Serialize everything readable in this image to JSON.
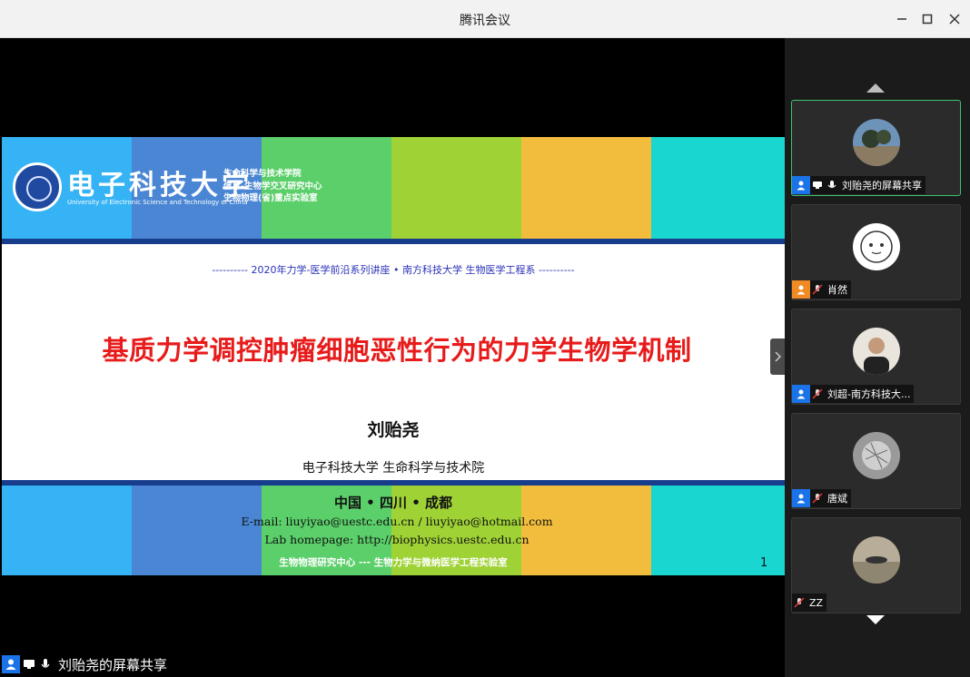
{
  "window": {
    "title": "腾讯会议"
  },
  "slide": {
    "university_cn": "电子科技大学",
    "university_en": "University of Electronic Science and Technology of China",
    "institute_lines": [
      "生命科学与技术学院",
      "信息-生物学交叉研究中心",
      "生物物理(省)重点实验室"
    ],
    "series": "---------- 2020年力学-医学前沿系列讲座 • 南方科技大学 生物医学工程系 ----------",
    "title": "基质力学调控肿瘤细胞恶性行为的力学生物学机制",
    "author": "刘贻尧",
    "affiliation": "电子科技大学 生命科学与技术院",
    "location": "中国 • 四川 • 成都",
    "email": "E-mail:  liuyiyao@uestc.edu.cn / liuyiyao@hotmail.com",
    "homepage": "Lab homepage: http://biophysics.uestc.edu.cn",
    "footer_lab": "生物物理研究中心 --- 生物力学与微纳医学工程实验室",
    "page_number": "1",
    "band_colors": [
      "#35b3f4",
      "#4a86d4",
      "#5bcf6a",
      "#9fd235",
      "#f2bd3c",
      "#19d6d0"
    ]
  },
  "share_status": {
    "label": "刘贻尧的屏幕共享"
  },
  "participants": [
    {
      "name": "刘贻尧的屏幕共享",
      "icon": "user-icon",
      "sharing": true,
      "mic": "on",
      "active": true
    },
    {
      "name": "肖然",
      "icon": "user-icon-orange",
      "sharing": false,
      "mic": "muted",
      "active": false
    },
    {
      "name": "刘超-南方科技大...",
      "icon": "user-icon",
      "sharing": false,
      "mic": "muted",
      "active": false
    },
    {
      "name": "唐斌",
      "icon": "user-icon",
      "sharing": false,
      "mic": "muted",
      "active": false
    },
    {
      "name": "ZZ",
      "icon": "",
      "sharing": false,
      "mic": "muted",
      "active": false
    }
  ],
  "colors": {
    "accent_blue": "#1a73e8",
    "active_border": "#3ec46d",
    "title_red": "#e81b1b",
    "series_blue": "#2a32b8"
  }
}
